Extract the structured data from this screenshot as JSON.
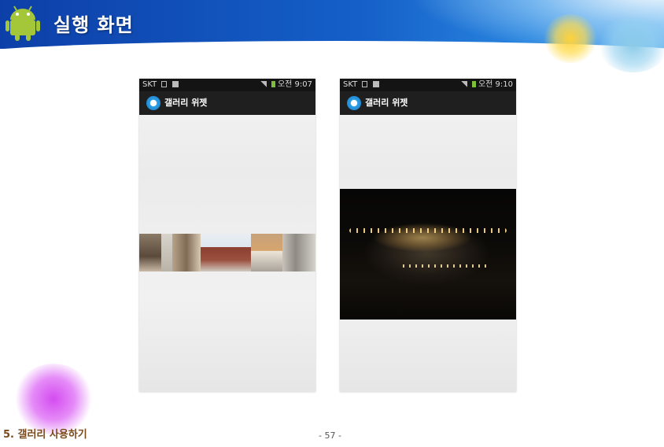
{
  "slide": {
    "title": "실행 화면",
    "footer_section": "5. 갤러리 사용하기",
    "page_number": "- 57 -"
  },
  "phones": [
    {
      "status": {
        "carrier": "SKT",
        "time": "오전 9:07"
      },
      "app_title": "갤러리 위젯",
      "content": "thumbnail-strip"
    },
    {
      "status": {
        "carrier": "SKT",
        "time": "오전 9:10"
      },
      "app_title": "갤러리 위젯",
      "content": "night-photo"
    }
  ],
  "colors": {
    "header_blue": "#1560c9",
    "footer_text": "#7a4a1c"
  }
}
